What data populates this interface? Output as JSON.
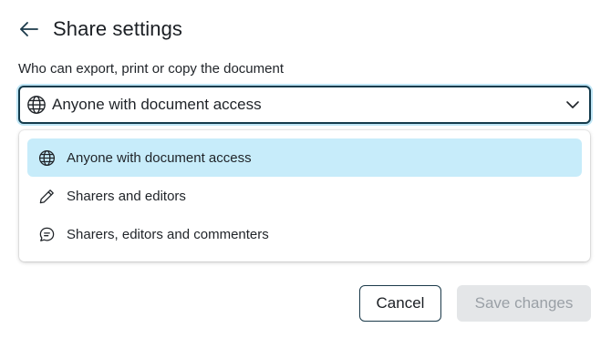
{
  "header": {
    "title": "Share settings",
    "back_icon": "arrow-left-icon"
  },
  "field": {
    "label": "Who can export, print or copy the document",
    "selected_value": "Anyone with document access",
    "selected_icon": "globe-icon",
    "dropdown_icon": "chevron-down-icon"
  },
  "menu": {
    "items": [
      {
        "label": "Anyone with document access",
        "icon": "globe-icon",
        "selected": true
      },
      {
        "label": "Sharers and editors",
        "icon": "pencil-icon",
        "selected": false
      },
      {
        "label": "Sharers, editors and commenters",
        "icon": "chat-bubble-icon",
        "selected": false
      }
    ]
  },
  "actions": {
    "cancel_label": "Cancel",
    "save_label": "Save changes",
    "save_disabled": true
  },
  "colors": {
    "focus_border": "#143b4c",
    "focus_ring": "#bfe6f6",
    "selected_item_bg": "#c7ecfa",
    "disabled_button_bg": "#e4e6e8",
    "disabled_button_text": "#9aa0a6"
  }
}
